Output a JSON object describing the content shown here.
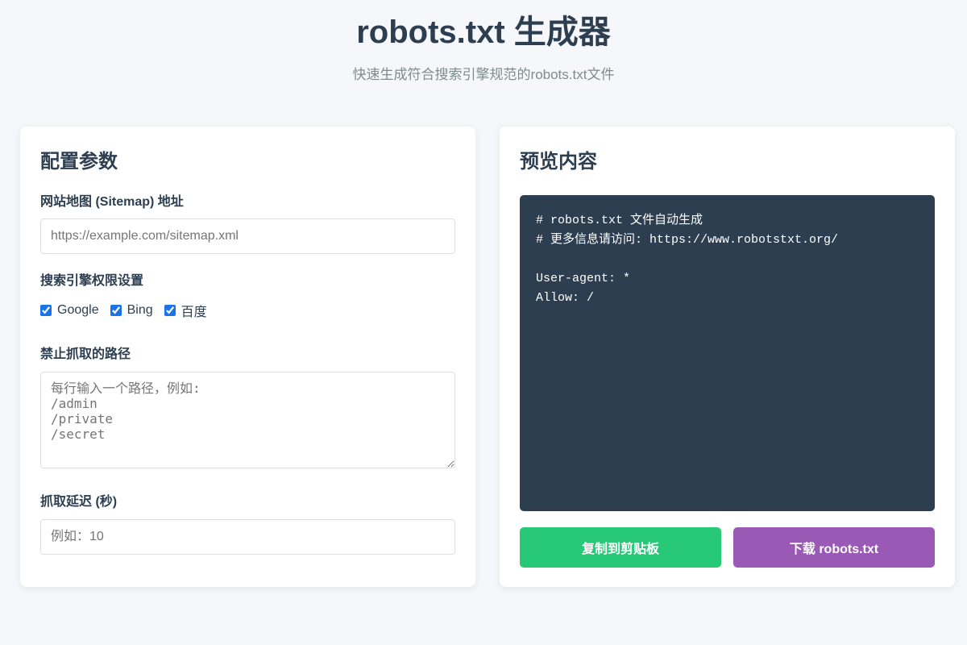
{
  "header": {
    "title": "robots.txt 生成器",
    "subtitle": "快速生成符合搜索引擎规范的robots.txt文件"
  },
  "config": {
    "heading": "配置参数",
    "sitemap": {
      "label": "网站地图 (Sitemap) 地址",
      "placeholder": "https://example.com/sitemap.xml",
      "value": ""
    },
    "engines": {
      "label": "搜索引擎权限设置",
      "items": [
        {
          "label": "Google",
          "checked": true
        },
        {
          "label": "Bing",
          "checked": true
        },
        {
          "label": "百度",
          "checked": true
        }
      ]
    },
    "disallow": {
      "label": "禁止抓取的路径",
      "placeholder": "每行输入一个路径，例如:\n/admin\n/private\n/secret",
      "value": ""
    },
    "delay": {
      "label": "抓取延迟 (秒)",
      "placeholder": "例如：10",
      "value": ""
    }
  },
  "preview": {
    "heading": "预览内容",
    "content": "# robots.txt 文件自动生成\n# 更多信息请访问: https://www.robotstxt.org/\n\nUser-agent: *\nAllow: /",
    "copy_label": "复制到剪贴板",
    "download_label": "下载 robots.txt"
  },
  "colors": {
    "preview_bg": "#2c3e50",
    "copy_button": "#27c878",
    "download_button": "#9b59b6",
    "checkbox_accent": "#1a73e8"
  }
}
